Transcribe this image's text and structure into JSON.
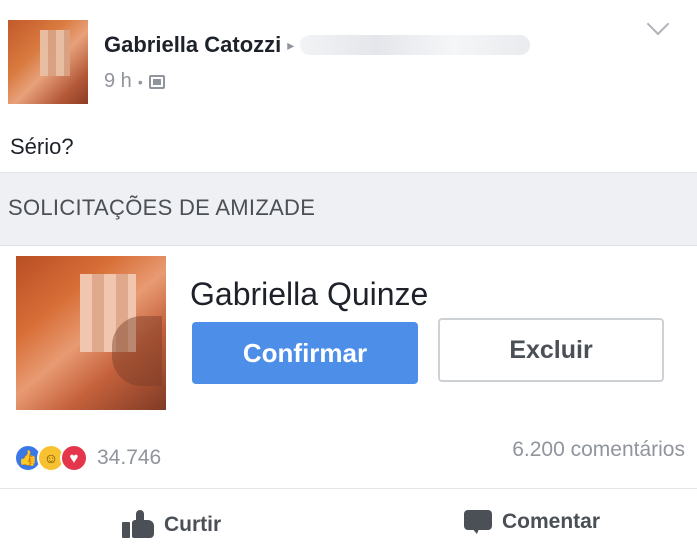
{
  "post": {
    "author": "Gabriella Catozzi",
    "time": "9 h",
    "text": "Sério?"
  },
  "section": {
    "title": "SOLICITAÇÕES DE AMIZADE"
  },
  "request": {
    "name": "Gabriella Quinze",
    "confirm_label": "Confirmar",
    "delete_label": "Excluir"
  },
  "stats": {
    "reactions_count": "34.746",
    "comments_count": "6.200 comentários"
  },
  "actions": {
    "like_label": "Curtir",
    "comment_label": "Comentar"
  },
  "colors": {
    "primary_button": "#4c8ee8",
    "section_band": "#eef0f3",
    "like_reaction": "#3b78e7",
    "haha_reaction": "#f7c12f",
    "love_reaction": "#e5354a"
  },
  "icons": {
    "share": "share-arrow-icon",
    "privacy": "group-icon",
    "menu": "chevron-down-icon",
    "like": "thumbs-up-icon",
    "comment": "comment-icon"
  }
}
